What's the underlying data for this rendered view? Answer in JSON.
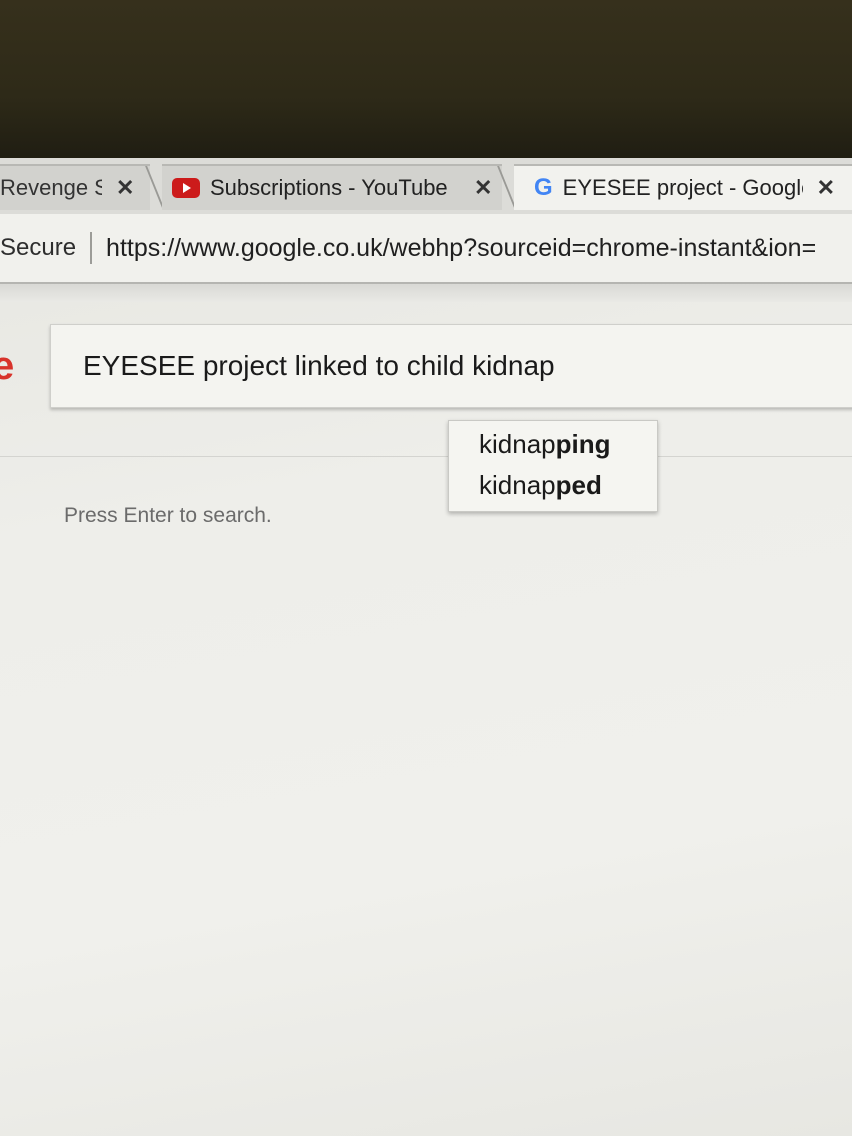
{
  "tabs": [
    {
      "title": "Revenge S",
      "close": "✕",
      "icon": "none",
      "active": false
    },
    {
      "title": "Subscriptions - YouTube",
      "close": "✕",
      "icon": "youtube-icon",
      "active": false
    },
    {
      "title": "EYESEE project - Google",
      "close": "✕",
      "icon": "google-g-icon",
      "g_letter": "G",
      "active": true
    }
  ],
  "address_bar": {
    "secure_label": "Secure",
    "url": "https://www.google.co.uk/webhp?sourceid=chrome-instant&ion="
  },
  "logo_fragment": "e",
  "search": {
    "value": "EYESEE project linked to child kidnap"
  },
  "autocomplete": {
    "items": [
      {
        "prefix": "kidnap",
        "completion": "ping"
      },
      {
        "prefix": "kidnap",
        "completion": "ped"
      }
    ]
  },
  "hint": "Press Enter to search.",
  "colors": {
    "youtube_red": "#cc1b1b",
    "google_blue": "#4285f4",
    "logo_red": "#d8332b"
  }
}
